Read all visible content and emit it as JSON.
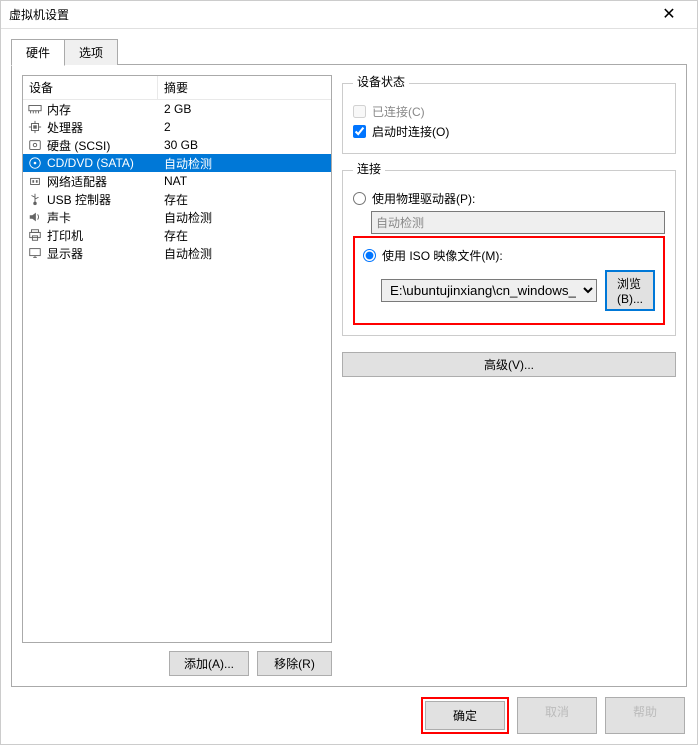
{
  "window": {
    "title": "虚拟机设置"
  },
  "tabs": [
    {
      "label": "硬件",
      "active": true
    },
    {
      "label": "选项",
      "active": false
    }
  ],
  "columns": {
    "device": "设备",
    "summary": "摘要"
  },
  "hardware": [
    {
      "icon": "memory",
      "label": "内存",
      "summary": "2 GB"
    },
    {
      "icon": "cpu",
      "label": "处理器",
      "summary": "2"
    },
    {
      "icon": "disk",
      "label": "硬盘 (SCSI)",
      "summary": "30 GB"
    },
    {
      "icon": "cd",
      "label": "CD/DVD (SATA)",
      "summary": "自动检测",
      "selected": true
    },
    {
      "icon": "net",
      "label": "网络适配器",
      "summary": "NAT"
    },
    {
      "icon": "usb",
      "label": "USB 控制器",
      "summary": "存在"
    },
    {
      "icon": "sound",
      "label": "声卡",
      "summary": "自动检测"
    },
    {
      "icon": "printer",
      "label": "打印机",
      "summary": "存在"
    },
    {
      "icon": "display",
      "label": "显示器",
      "summary": "自动检测"
    }
  ],
  "leftButtons": {
    "add": "添加(A)...",
    "remove": "移除(R)"
  },
  "deviceStatus": {
    "legend": "设备状态",
    "connected": "已连接(C)",
    "connectAtPowerOn": "启动时连接(O)"
  },
  "connection": {
    "legend": "连接",
    "physicalRadio": "使用物理驱动器(P):",
    "physicalDropdown": "自动检测",
    "isoRadio": "使用 ISO 映像文件(M):",
    "isoPath": "E:\\ubuntujinxiang\\cn_windows_",
    "browse": "浏览(B)..."
  },
  "advanced": "高级(V)...",
  "footer": {
    "ok": "确定",
    "cancel": "取消",
    "help": "帮助"
  }
}
